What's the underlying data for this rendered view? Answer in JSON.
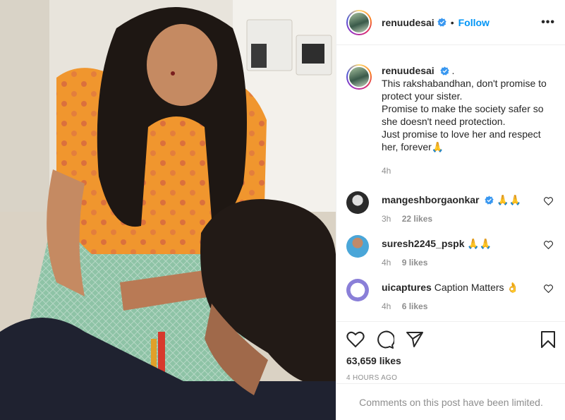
{
  "post": {
    "username": "renuudesai",
    "follow_label": "Follow",
    "more_label": "•••",
    "separator": "•"
  },
  "caption": {
    "username": "renuudesai",
    "suffix": ".",
    "lines": [
      "This rakshabandhan, don't promise to",
      "protect your sister.",
      "Promise to make the society safer so",
      "she doesn't need protection.",
      "Just promise to love her and respect",
      "her, forever🙏"
    ],
    "time": "4h"
  },
  "comments": [
    {
      "username": "mangeshborgaonkar",
      "text": "🙏🙏",
      "time": "3h",
      "likes": "22 likes"
    },
    {
      "username": "suresh2245_pspk",
      "text": "🙏🙏",
      "time": "4h",
      "likes": "9 likes"
    },
    {
      "username": "uicaptures",
      "text": "Caption Matters 👌",
      "time": "4h",
      "likes": "6 likes"
    }
  ],
  "footer": {
    "likes": "63,659 likes",
    "timestamp": "4 HOURS AGO",
    "limited_notice": "Comments on this post have been limited."
  },
  "icons": {
    "like": "heart-icon",
    "comment": "comment-icon",
    "share": "paper-plane-icon",
    "save": "bookmark-icon",
    "verified": "verified-badge-icon"
  },
  "colors": {
    "accent": "#0095f6",
    "muted": "#8e8e8e",
    "text": "#262626",
    "border": "#efefef"
  }
}
